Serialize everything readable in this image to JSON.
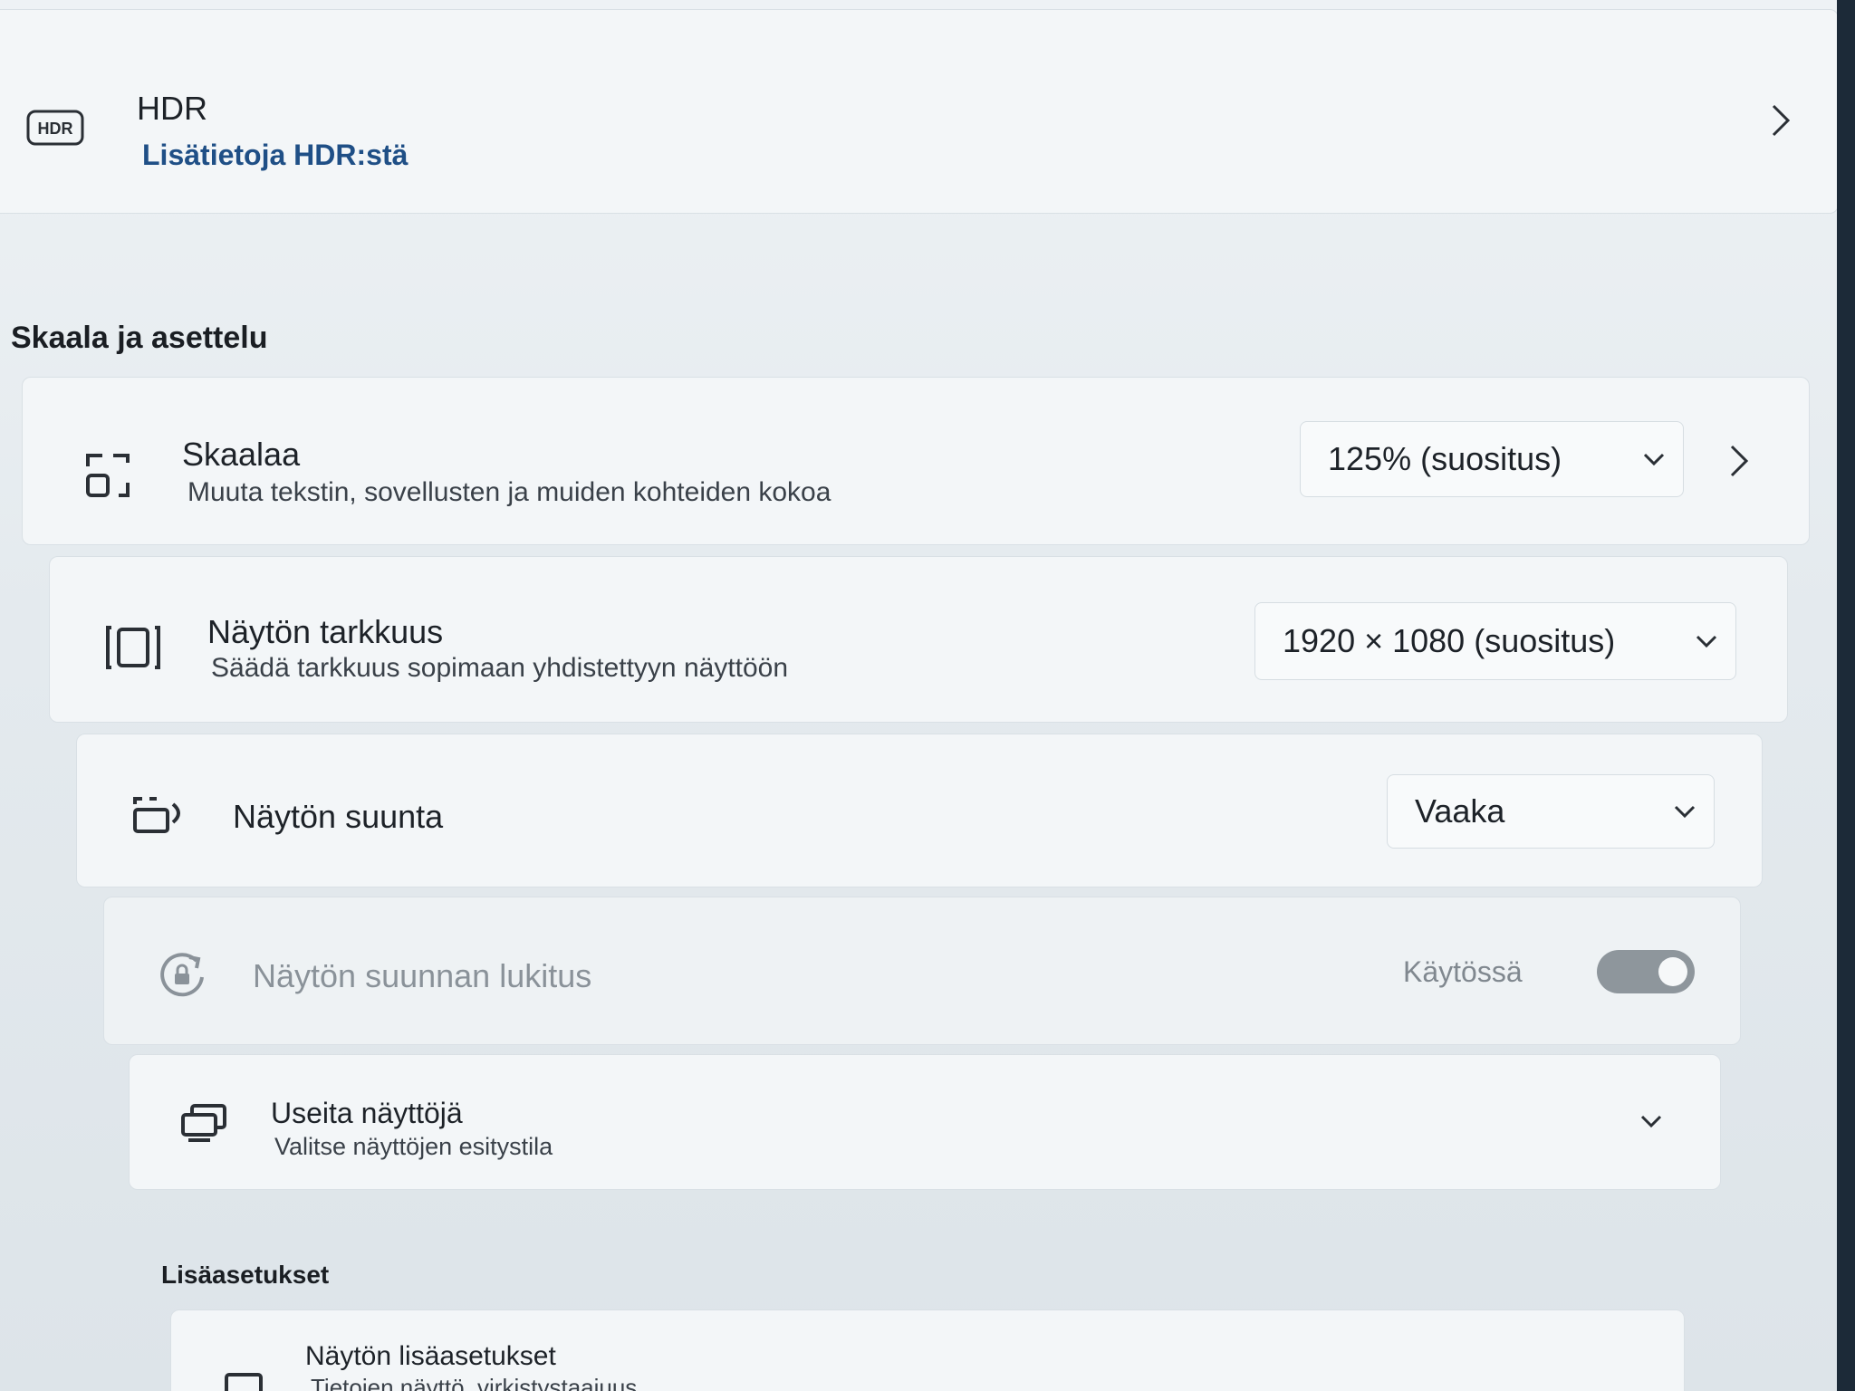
{
  "hdr": {
    "icon": "hdr-icon",
    "icon_text": "HDR",
    "title": "HDR",
    "link": "Lisätietoja HDR:stä"
  },
  "scale_section": {
    "heading": "Skaala ja asettelu",
    "items": [
      {
        "icon": "scale-icon",
        "title": "Skaalaa",
        "subtitle": "Muuta tekstin, sovellusten ja muiden kohteiden kokoa",
        "value": "125% (suositus)"
      },
      {
        "icon": "resolution-icon",
        "title": "Näytön tarkkuus",
        "subtitle": "Säädä tarkkuus sopimaan yhdistettyyn näyttöön",
        "value": "1920 × 1080 (suositus)"
      },
      {
        "icon": "orientation-icon",
        "title": "Näytön suunta",
        "value": "Vaaka"
      },
      {
        "icon": "rotation-lock-icon",
        "title": "Näytön suunnan lukitus",
        "state_label": "Käytössä",
        "toggle_on": true,
        "disabled": true
      },
      {
        "icon": "multiple-displays-icon",
        "title": "Useita näyttöjä",
        "subtitle": "Valitse näyttöjen esitystila"
      }
    ]
  },
  "advanced_section": {
    "heading": "Lisäasetukset",
    "items": [
      {
        "icon": "monitor-icon",
        "title": "Näytön lisäasetukset",
        "subtitle": "Tietojen näyttö, virkistystaajuus"
      }
    ]
  }
}
